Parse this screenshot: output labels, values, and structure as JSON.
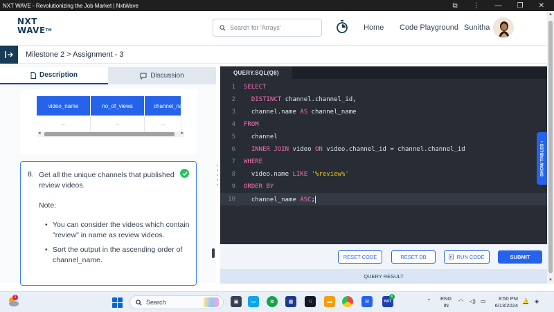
{
  "window": {
    "title": "NXT WAVE - Revolutionizing the Job Market | NxtWave"
  },
  "header": {
    "logo_line1": "NXT",
    "logo_line2": "WAVE",
    "logo_tm": "TM",
    "search_placeholder": "Search for 'Arrays'",
    "nav_home": "Home",
    "nav_code_playground": "Code Playground",
    "user_name": "Sunitha"
  },
  "milestone": {
    "breadcrumb": "Milestone 2 > Assignment - 3"
  },
  "left_panel": {
    "tab_description": "Description",
    "tab_discussion": "Discussion",
    "table": {
      "columns": [
        "video_name",
        "no_of_views",
        "channel_na"
      ],
      "row": [
        "...",
        "...",
        "..."
      ]
    },
    "question": {
      "number": "8.",
      "text": "Get all the unique channels that published review videos.",
      "note_label": "Note:",
      "bullets": [
        "You can consider the videos which contain \"review\" in name as review videos.",
        "Sort the output in the ascending order of channel_name."
      ]
    }
  },
  "editor": {
    "tab_label": "QUERY.SQL(Q8)",
    "line_numbers": [
      "1",
      "2",
      "3",
      "4",
      "5",
      "6",
      "7",
      "8",
      "9",
      "10"
    ],
    "show_tables_label": "SHOW TABLES"
  },
  "actions": {
    "reset_code": "RESET CODE",
    "reset_db": "RESET DB",
    "run_code": "RUN CODE",
    "submit": "SUBMIT",
    "query_result": "QUERY RESULT"
  },
  "taskbar": {
    "weather_badge": "1",
    "search_label": "Search",
    "lang_line1": "ENG",
    "lang_line2": "IN",
    "time": "8:50 PM",
    "date": "6/13/2024",
    "nxtwave_badge": "6"
  },
  "colors": {
    "brand_navy": "#183b56",
    "accent_blue": "#2563eb",
    "editor_bg": "#272c35",
    "keyword_pink": "#f472b6",
    "string_yellow": "#facc15",
    "success_green": "#22c55e"
  }
}
